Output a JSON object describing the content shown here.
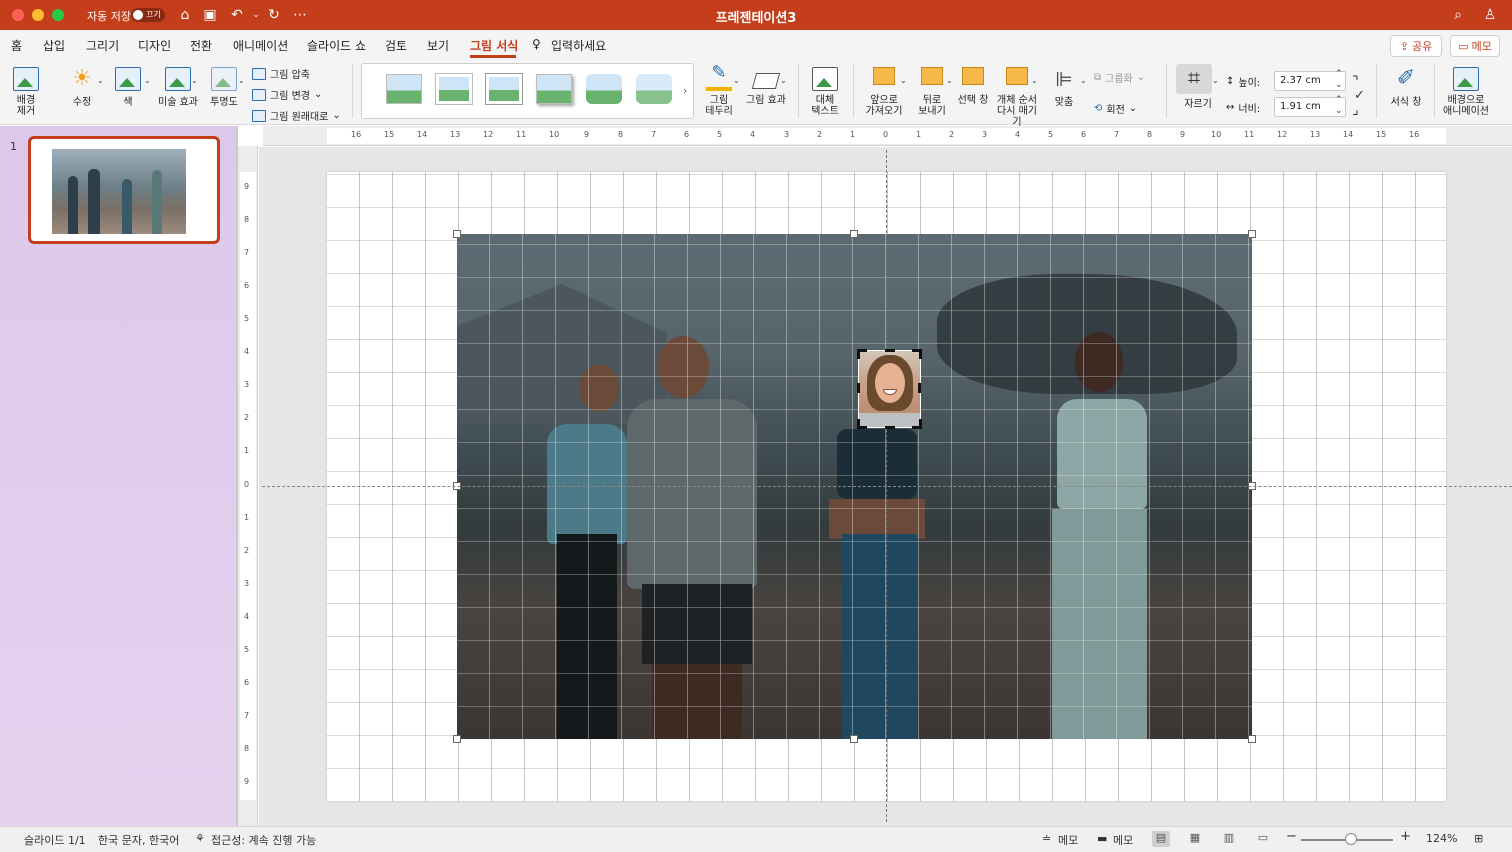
{
  "window": {
    "autosave_label": "자동 저장",
    "autosave_state": "끄기",
    "title": "프레젠테이션3"
  },
  "tabs": [
    "홈",
    "삽입",
    "그리기",
    "디자인",
    "전환",
    "애니메이션",
    "슬라이드 쇼",
    "검토",
    "보기",
    "그림 서식"
  ],
  "tell_me": "입력하세요",
  "share_label": "공유",
  "memo_label": "메모",
  "ribbon": {
    "remove_bg": "배경\n제거",
    "corrections": "수정",
    "color": "색",
    "artistic": "미술 효과",
    "transparency": "투명도",
    "compress": "그림 압축",
    "change_picture": "그림 변경",
    "reset_picture": "그림 원래대로",
    "picture_border": "그림\n테두리",
    "picture_effects": "그림 효과",
    "alt_text": "대체\n텍스트",
    "bring_forward": "앞으로\n가져오기",
    "send_backward": "뒤로\n보내기",
    "selection_pane": "선택 창",
    "reorder": "개체 순서\n다시 매기기",
    "align": "맞춤",
    "group": "그룹화",
    "rotate": "회전",
    "crop": "자르기",
    "height_label": "높이:",
    "height_value": "2.37 cm",
    "width_label": "너비:",
    "width_value": "1.91 cm",
    "format_pane": "서식 창",
    "animate_bg": "배경으로\n애니메이션"
  },
  "slide_panel": {
    "slide_number": "1"
  },
  "ruler": {
    "h": [
      "16",
      "15",
      "14",
      "13",
      "12",
      "11",
      "10",
      "9",
      "8",
      "7",
      "6",
      "5",
      "4",
      "3",
      "2",
      "1",
      "0",
      "1",
      "2",
      "3",
      "4",
      "5",
      "6",
      "7",
      "8",
      "9",
      "10",
      "11",
      "12",
      "13",
      "14",
      "15",
      "16"
    ],
    "v": [
      "9",
      "8",
      "7",
      "6",
      "5",
      "4",
      "3",
      "2",
      "1",
      "0",
      "1",
      "2",
      "3",
      "4",
      "5",
      "6",
      "7",
      "8",
      "9"
    ]
  },
  "status": {
    "slide_info": "슬라이드 1/1",
    "language": "한국 문자, 한국어",
    "accessibility": "접근성: 계속 진행 가능",
    "notes": "메모",
    "comments": "메모",
    "zoom": "124%"
  }
}
